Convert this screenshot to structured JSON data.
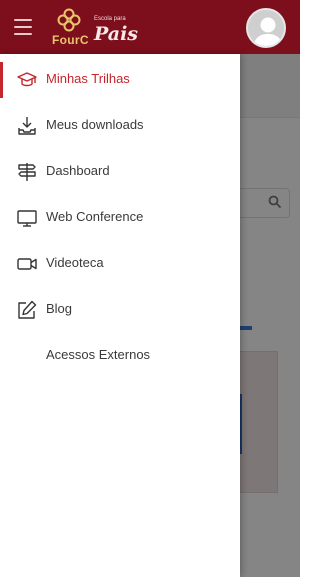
{
  "header": {
    "logo": {
      "brand": "FourC",
      "tagline": "Escola para",
      "product": "Pais"
    },
    "colors": {
      "bar": "#7d0f1c",
      "accent": "#c5252d"
    },
    "menu_icon": "hamburger-icon",
    "avatar_icon": "user-avatar-icon"
  },
  "drawer": {
    "items": [
      {
        "label": "Minhas Trilhas",
        "icon": "graduation-cap-icon",
        "active": true
      },
      {
        "label": "Meus downloads",
        "icon": "download-icon",
        "active": false
      },
      {
        "label": "Dashboard",
        "icon": "signpost-icon",
        "active": false
      },
      {
        "label": "Web Conference",
        "icon": "monitor-icon",
        "active": false
      },
      {
        "label": "Videoteca",
        "icon": "video-camera-icon",
        "active": false
      },
      {
        "label": "Blog",
        "icon": "edit-icon",
        "active": false
      },
      {
        "label": "Acessos Externos",
        "icon": "",
        "active": false
      }
    ]
  }
}
